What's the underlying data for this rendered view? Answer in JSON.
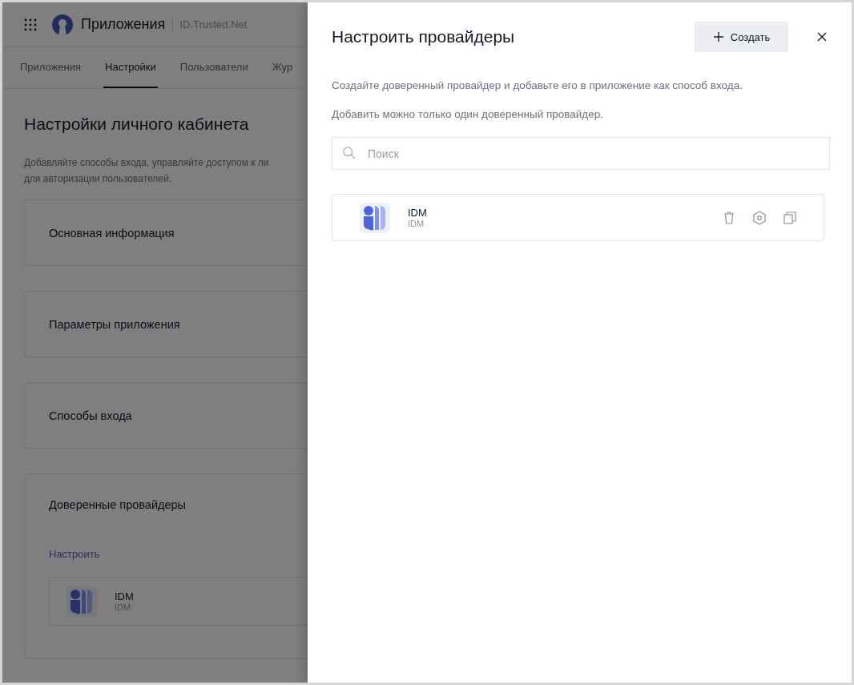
{
  "app_header": {
    "title": "Приложения",
    "org": "ID.Trusted.Net"
  },
  "nav_tabs": [
    {
      "label": "Приложения",
      "selected": false
    },
    {
      "label": "Настройки",
      "selected": true
    },
    {
      "label": "Пользователи",
      "selected": false
    },
    {
      "label": "Жур",
      "selected": false
    }
  ],
  "page": {
    "title": "Настройки личного кабинета",
    "description_lines": [
      "Добавляйте способы входа, управляйте доступом к ли",
      "для авторизации пользователей."
    ],
    "sections": [
      {
        "kind": "plain",
        "title": "Основная информация"
      },
      {
        "kind": "plain",
        "title": "Параметры приложения"
      },
      {
        "kind": "plain",
        "title": "Способы входа"
      },
      {
        "kind": "providers",
        "title": "Доверенные провайдеры",
        "link": "Настроить",
        "providers": [
          {
            "name": "IDM",
            "subtitle": "IDM"
          }
        ]
      }
    ]
  },
  "drawer": {
    "title": "Настроить провайдеры",
    "create_button": {
      "label": "Создать"
    },
    "notes": [
      "Создайте доверенный провайдер и добавьте его в приложение как способ входа.",
      "Добавить можно только один доверенный провайдер."
    ],
    "search": {
      "placeholder": "Поиск"
    },
    "providers": [
      {
        "name": "IDM",
        "subtitle": "IDM"
      }
    ]
  }
}
